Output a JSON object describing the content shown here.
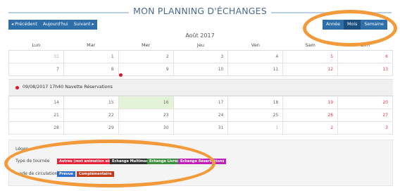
{
  "title": "MON PLANNING D'ÉCHANGES",
  "nav": {
    "prev": "◂ Précédent",
    "today": "Aujourd'hui",
    "next": "Suivant ▸"
  },
  "views": [
    {
      "label": "Année",
      "active": false
    },
    {
      "label": "Mois",
      "active": true
    },
    {
      "label": "Semaine",
      "active": false
    }
  ],
  "month_label": "Août 2017",
  "weekdays": [
    "Lun",
    "Mar",
    "Mer",
    "Jeu",
    "Ven",
    "Sam",
    "Dim"
  ],
  "weeks": [
    [
      "31",
      "1",
      "2",
      "3",
      "4",
      "5",
      "6"
    ],
    [
      "7",
      "8",
      "9",
      "10",
      "11",
      "12",
      "13"
    ],
    [
      "14",
      "15",
      "16",
      "17",
      "18",
      "19",
      "20"
    ],
    [
      "21",
      "22",
      "23",
      "24",
      "25",
      "26",
      "27"
    ],
    [
      "28",
      "29",
      "30",
      "31",
      "1",
      "2",
      "3"
    ]
  ],
  "event": {
    "text": "09/08/2017 17h40 Navette Réservations"
  },
  "legend": {
    "heading": "Légen",
    "tour_type_label": "Type de tournée",
    "tour_types": [
      {
        "label": "Autres (mot animation etc)",
        "color": "#e8243c"
      },
      {
        "label": "Echange Multimedia",
        "color": "#333333"
      },
      {
        "label": "Echange Livres",
        "color": "#3c8f3c"
      },
      {
        "label": "Echange Réservations",
        "color": "#c020b8"
      }
    ],
    "circulation_label": "...ode de circulation",
    "circulation_types": [
      {
        "label": "Prévue",
        "color": "#2f6fd0"
      },
      {
        "label": "Complémentaire",
        "color": "#c23a1a"
      }
    ]
  },
  "colors": {
    "accent": "#2f6fa9",
    "weekend": "#d9364a",
    "today_bg": "#e3f3d8",
    "annotation": "#f39a3a"
  }
}
